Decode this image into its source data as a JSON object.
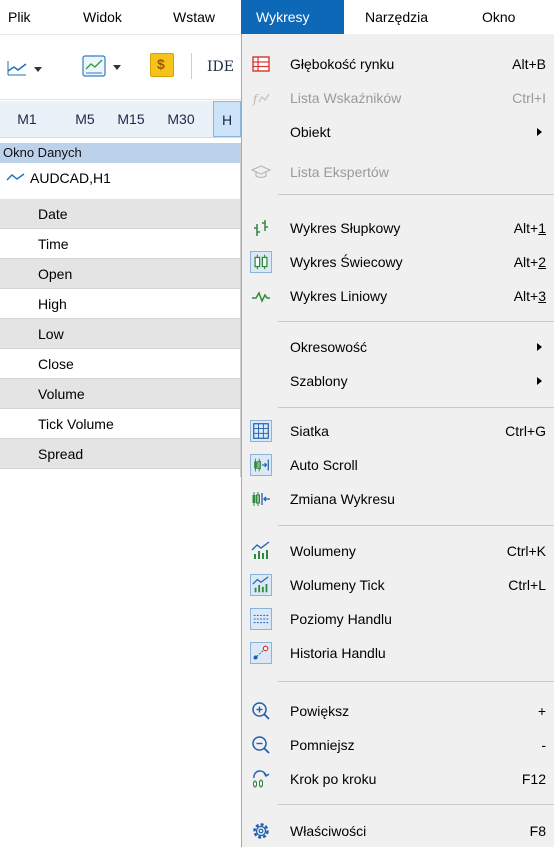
{
  "menubar": {
    "items": [
      "Plik",
      "Widok",
      "Wstaw",
      "Wykresy",
      "Narzędzia",
      "Okno"
    ]
  },
  "toolbar": {
    "buttons": [
      "line-chart-dropdown",
      "template-dropdown",
      "trading-dollar",
      "ide"
    ],
    "ide_label": "IDE",
    "dollar_glyph": "$"
  },
  "timeframes": {
    "items": [
      "M1",
      "M5",
      "M15",
      "M30",
      "H"
    ],
    "selected": "H"
  },
  "data_window": {
    "title": "Okno Danych",
    "symbol": "AUDCAD,H1",
    "rows": [
      "Date",
      "Time",
      "Open",
      "High",
      "Low",
      "Close",
      "Volume",
      "Tick Volume",
      "Spread"
    ]
  },
  "menu": {
    "groups": [
      [
        {
          "label": "Głębokość rynku",
          "shortcut": "Alt+B",
          "icon": "market-depth-icon",
          "enabled": true
        },
        {
          "label": "Lista Wskaźników",
          "shortcut": "Ctrl+I",
          "icon": "indicators-list-icon",
          "enabled": false
        },
        {
          "label": "Obiekt",
          "shortcut": "",
          "icon": "",
          "enabled": true,
          "submenu": true
        },
        {
          "label": "Lista Ekspertów",
          "shortcut": "",
          "icon": "experts-list-icon",
          "enabled": false
        }
      ],
      [
        {
          "label": "Wykres Słupkowy",
          "shortcut_pre": "Alt+",
          "shortcut_key": "1",
          "icon": "bar-chart-icon",
          "enabled": true
        },
        {
          "label": "Wykres Świecowy",
          "shortcut_pre": "Alt+",
          "shortcut_key": "2",
          "icon": "candlestick-icon",
          "enabled": true,
          "checked": true
        },
        {
          "label": "Wykres Liniowy",
          "shortcut_pre": "Alt+",
          "shortcut_key": "3",
          "icon": "line-chart-icon",
          "enabled": true
        }
      ],
      [
        {
          "label": "Okresowość",
          "icon": "",
          "enabled": true,
          "submenu": true
        },
        {
          "label": "Szablony",
          "icon": "",
          "enabled": true,
          "submenu": true
        }
      ],
      [
        {
          "label": "Siatka",
          "shortcut": "Ctrl+G",
          "icon": "grid-icon",
          "enabled": true,
          "checked": true
        },
        {
          "label": "Auto Scroll",
          "shortcut": "",
          "icon": "auto-scroll-icon",
          "enabled": true,
          "checked": true
        },
        {
          "label": "Zmiana Wykresu",
          "shortcut": "",
          "icon": "chart-shift-icon",
          "enabled": true
        }
      ],
      [
        {
          "label": "Wolumeny",
          "shortcut": "Ctrl+K",
          "icon": "volumes-icon",
          "enabled": true
        },
        {
          "label": "Wolumeny Tick",
          "shortcut": "Ctrl+L",
          "icon": "tick-volumes-icon",
          "enabled": true,
          "checked": true
        },
        {
          "label": "Poziomy Handlu",
          "shortcut": "",
          "icon": "trade-levels-icon",
          "enabled": true,
          "checked": true
        },
        {
          "label": "Historia Handlu",
          "shortcut": "",
          "icon": "trade-history-icon",
          "enabled": true,
          "checked": true
        }
      ],
      [
        {
          "label": "Powiększ",
          "shortcut": "+",
          "icon": "zoom-in-icon",
          "enabled": true
        },
        {
          "label": "Pomniejsz",
          "shortcut": "-",
          "icon": "zoom-out-icon",
          "enabled": true
        },
        {
          "label": "Krok po kroku",
          "shortcut": "F12",
          "icon": "step-icon",
          "enabled": true
        }
      ],
      [
        {
          "label": "Właściwości",
          "shortcut": "F8",
          "icon": "properties-icon",
          "enabled": true
        }
      ]
    ]
  },
  "colors": {
    "menu_active_bg": "#0d68b8",
    "menu_bg": "#f0f0f0",
    "checked_icon_bg": "#dbe8f6",
    "data_header_bg": "#bcd1ea"
  }
}
